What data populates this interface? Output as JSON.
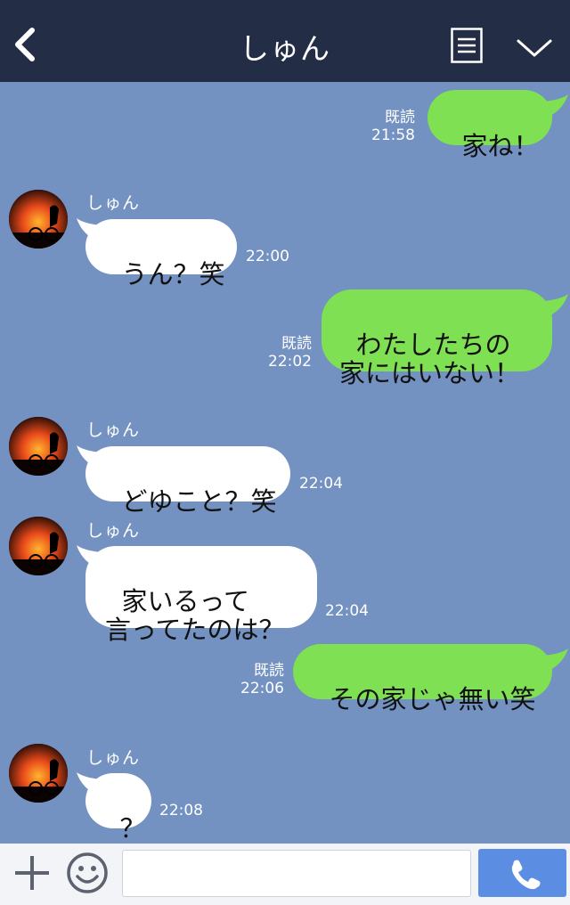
{
  "header": {
    "title": "しゅん",
    "back_icon": "chevron-left-icon",
    "menu_icon": "menu-list-icon",
    "collapse_icon": "chevron-down-icon"
  },
  "messages": [
    {
      "side": "out",
      "text": "家ね！",
      "read": "既読",
      "time": "21:58"
    },
    {
      "side": "in",
      "sender": "しゅん",
      "text": "うん？笑",
      "time": "22:00"
    },
    {
      "side": "out",
      "text": "わたしたちの\n家にはいない！",
      "read": "既読",
      "time": "22:02"
    },
    {
      "side": "in",
      "sender": "しゅん",
      "text": "どゆこと？笑",
      "time": "22:04"
    },
    {
      "side": "in",
      "sender": "しゅん",
      "text": "家いるって\n言ってたのは？",
      "time": "22:04"
    },
    {
      "side": "out",
      "text": "その家じゃ無い笑",
      "read": "既読",
      "time": "22:06"
    },
    {
      "side": "in",
      "sender": "しゅん",
      "text": "？",
      "time": "22:08"
    }
  ],
  "inputbar": {
    "plus_icon": "plus-icon",
    "emoji_icon": "smiley-icon",
    "message_placeholder": "",
    "call_icon": "phone-icon"
  },
  "colors": {
    "header_bg": "#232d45",
    "chat_bg": "#7392c1",
    "outgoing_bubble": "#7ee052",
    "incoming_bubble": "#ffffff",
    "call_button": "#5b8de3"
  }
}
